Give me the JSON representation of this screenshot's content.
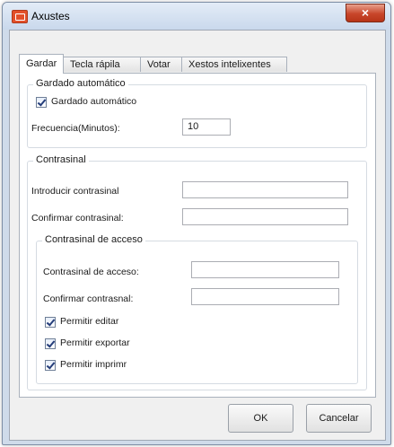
{
  "window": {
    "title": "Axustes",
    "close_glyph": "×"
  },
  "tabs": [
    {
      "label": "Gardar",
      "selected": true
    },
    {
      "label": "Tecla rápila"
    },
    {
      "label": "Votar"
    },
    {
      "label": "Xestos intelixentes"
    }
  ],
  "autosave": {
    "legend": "Gardado automático",
    "checkbox_label": "Gardado automático",
    "checked": true,
    "freq_label": "Frecuencia(Minutos):",
    "freq_value": "10"
  },
  "password": {
    "legend": "Contrasinal",
    "enter_label": "Introducir contrasinal",
    "confirm_label": "Confirmar contrasinal:",
    "access": {
      "legend": "Contrasinal de acceso",
      "access_label": "Contrasinal de acceso:",
      "confirm_label": "Confirmar contrasnal:",
      "permissions": [
        {
          "label": "Permitir editar",
          "checked": true
        },
        {
          "label": "Permitir exportar",
          "checked": true
        },
        {
          "label": "Permitir imprimr",
          "checked": true
        }
      ]
    }
  },
  "buttons": {
    "ok": "OK",
    "cancel": "Cancelar"
  },
  "colors": {
    "close_button": "#c8462a",
    "app_icon": "#e3502a",
    "frame": "#cfdbea"
  }
}
